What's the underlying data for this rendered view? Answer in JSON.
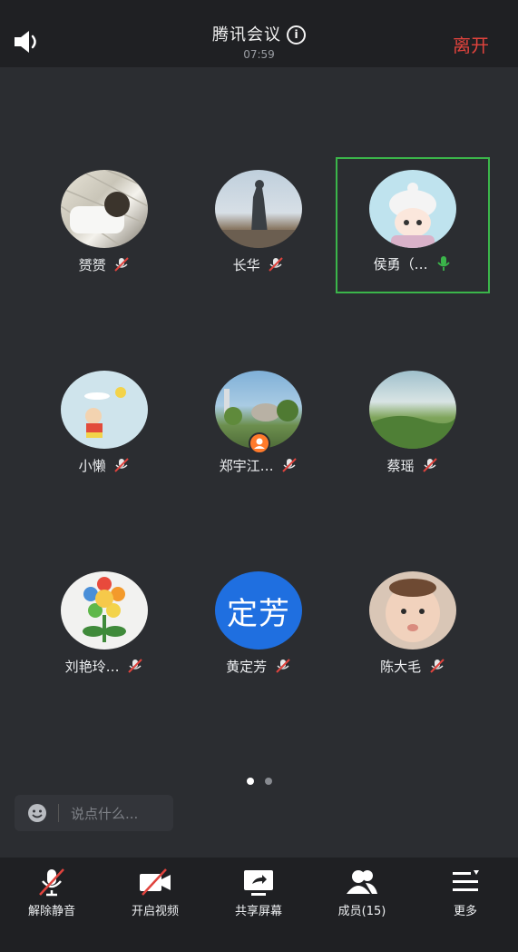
{
  "header": {
    "title": "腾讯会议",
    "info_icon": "info-icon",
    "time": "07:59",
    "leave_label": "离开",
    "leave_color": "#e0433d"
  },
  "participants": [
    {
      "name": "赟赟",
      "mic": "muted"
    },
    {
      "name": "长华",
      "mic": "muted"
    },
    {
      "name": "侯勇（…",
      "mic": "speaking",
      "active": true
    },
    {
      "name": "小懒",
      "mic": "muted"
    },
    {
      "name": "郑宇江…",
      "mic": "muted",
      "host_badge": true
    },
    {
      "name": "蔡瑶",
      "mic": "muted"
    },
    {
      "name": "刘艳玲…",
      "mic": "muted"
    },
    {
      "name": "黄定芳",
      "mic": "muted",
      "avatar_text": "定芳"
    },
    {
      "name": "陈大毛",
      "mic": "muted"
    }
  ],
  "pager": {
    "pages": 2,
    "current": 1
  },
  "chat": {
    "placeholder": "说点什么..."
  },
  "toolbar": {
    "unmute_label": "解除静音",
    "video_label": "开启视频",
    "share_label": "共享屏幕",
    "members_label": "成员(15)",
    "more_label": "更多"
  },
  "colors": {
    "speaking": "#3bb54a",
    "active_border": "#3bb54a",
    "background": "#2b2d31"
  }
}
